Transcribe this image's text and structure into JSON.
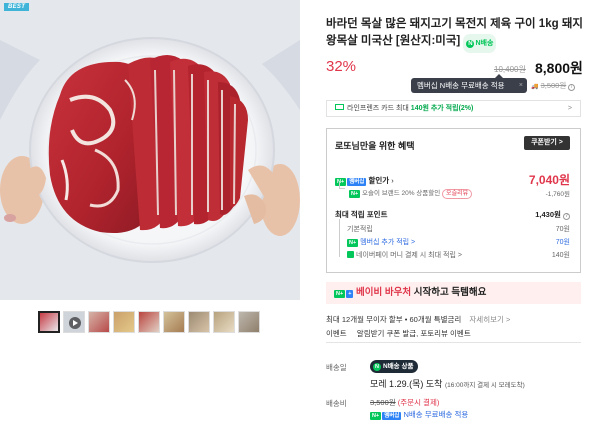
{
  "gallery": {
    "best_badge": "BEST",
    "thumbnail_count": 9,
    "selected_index": 0
  },
  "product": {
    "title": "바라던 목살 많은 돼지고기 목전지 제육 구이 1kg 돼지 왕목살 미국산 [원산지:미국]",
    "npay_label": "N배송",
    "discount_rate": "32%",
    "original_price": "10,400원",
    "price": "8,800원"
  },
  "tooltip": {
    "text": "멤버십 N배송 무료배송 적용",
    "close": "×"
  },
  "shipping_original": {
    "prefix": "🚚",
    "value": "3,500원",
    "info": "i"
  },
  "card_promo": {
    "prefix": "라인프렌즈 카드 최대 ",
    "highlight": "140원 추가 적립(2%)",
    "arrow": ">"
  },
  "benefit": {
    "header": "로또님만을 위한 혜택",
    "coupon_button": "쿠폰받기 >",
    "discount_label": "할인가",
    "discount_price": "7,040원",
    "brand_sale_text": "오슬이 브랜드 20% 상품할인",
    "brand_sale_badge": "오슬리뷰",
    "brand_sale_amount": "-1,760원",
    "points_label": "최대 적립 포인트",
    "points_value": "1,430원",
    "points_info": "?",
    "basic_label": "기본적립",
    "basic_value": "70원",
    "membership_label": "멤버십 추가 적립 >",
    "membership_value": "70원",
    "naverpay_label": "네이버페이 머니 결제 시 최대 적립 >",
    "naverpay_value": "140원",
    "nplus": "N+",
    "membership_tag": "멤버십"
  },
  "baby_voucher": {
    "brand": "베이비 바우처",
    "text": " 시작하고 득템해요"
  },
  "promos": {
    "installment": "최대 12개월 무이자 할부 • 60개월 특별금리",
    "installment_more": "자세히보기 >",
    "event_label": "이벤트",
    "event_text": "알림받기 쿠폰 발급, 포토리뷰 이벤트"
  },
  "delivery": {
    "label": "배송일",
    "badge": "N배송 상품",
    "date": "모레 1.29.(목) 도착",
    "date_note": "(16:00까지 결제 시 모레도착)",
    "fee_label": "배송비",
    "fee_value": "3,500원",
    "fee_note": "(주문시 결제)",
    "free_label": "N배송 무료배송 적용"
  },
  "colors": {
    "discount": "#e0364b",
    "naver_green": "#03c75a",
    "membership_blue": "#2d83f6"
  }
}
